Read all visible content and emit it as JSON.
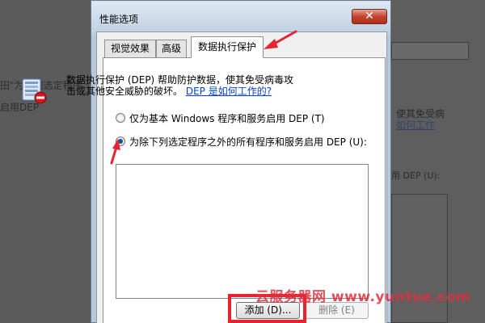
{
  "background": {
    "left_line1": "田\"为下列选定程序",
    "left_line2": "启用DEP",
    "right_line1": "使其免受病",
    "right_line2": "如何工作",
    "right_line3": "用 DEP (U):"
  },
  "dialog": {
    "title": "性能选项",
    "close_symbol": "✕",
    "tabs": [
      {
        "label": "视觉效果"
      },
      {
        "label": "高级"
      },
      {
        "label": "数据执行保护"
      }
    ],
    "description": "数据执行保护 (DEP) 帮助防护数据，使其免受病毒攻击或其他安全威胁的破坏。",
    "help_link": "DEP 是如何工作的?",
    "radio_basic_label": "仅为基本 Windows 程序和服务启用 DEP (T)",
    "radio_all_label": "为除下列选定程序之外的所有程序和服务启用 DEP (U):",
    "add_button": "添加 (D)...",
    "delete_button": "删除 (E)"
  },
  "annotation": {
    "watermark": "云服务器网 www.yuntue.com",
    "color": "#e8232d"
  }
}
